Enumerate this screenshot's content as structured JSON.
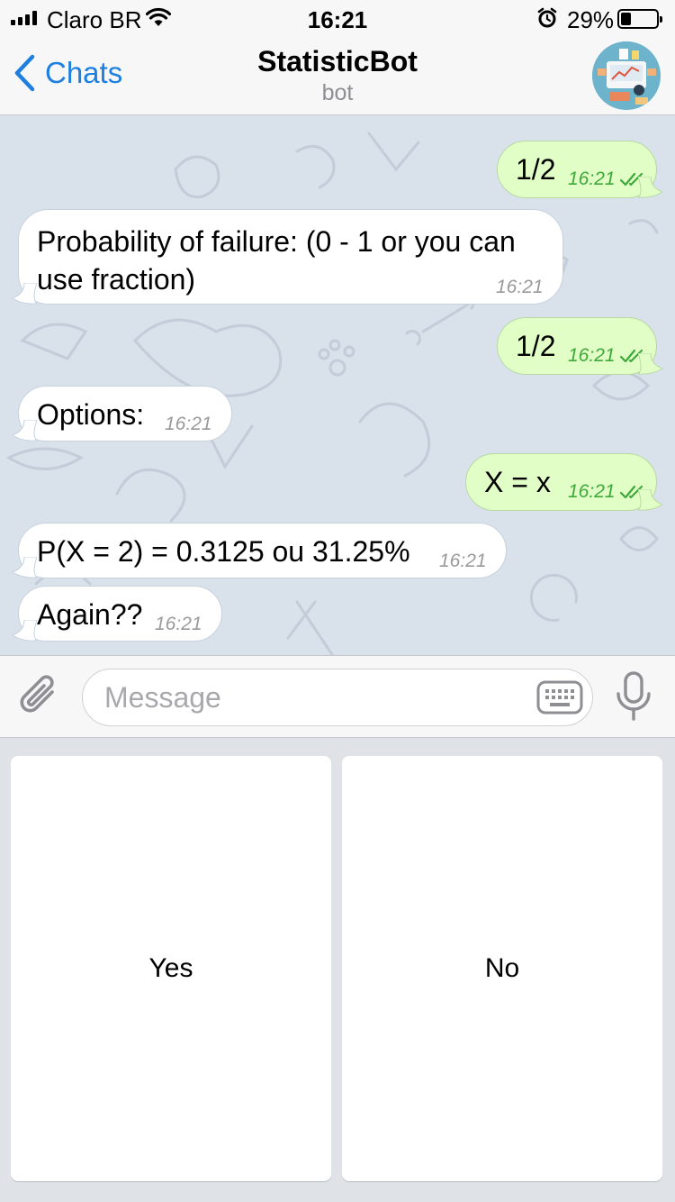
{
  "status_bar": {
    "carrier": "Claro BR",
    "time": "16:21",
    "battery_percent": "29%",
    "battery_level": 0.29,
    "icons": [
      "signal-icon",
      "wifi-icon",
      "alarm-icon",
      "battery-icon"
    ]
  },
  "nav": {
    "back_label": "Chats",
    "title": "StatisticBot",
    "subtitle": "bot"
  },
  "colors": {
    "accent": "#1d7fe0",
    "outgoing_bubble": "#e1fec6",
    "incoming_bubble": "#ffffff",
    "read_ticks": "#3ea93a",
    "chat_background": "#d9e1ea"
  },
  "messages": [
    {
      "direction": "out",
      "text": "1/2",
      "time": "16:21",
      "read": true
    },
    {
      "direction": "in",
      "lines": [
        "Probability of failure: (0 - 1 or you can",
        "use fraction)"
      ],
      "time": "16:21"
    },
    {
      "direction": "out",
      "text": "1/2",
      "time": "16:21",
      "read": true
    },
    {
      "direction": "in",
      "text": "Options:",
      "time": "16:21"
    },
    {
      "direction": "out",
      "text": "X = x",
      "time": "16:21",
      "read": true
    },
    {
      "direction": "in",
      "text": "P(X = 2) = 0.3125 ou 31.25%",
      "time": "16:21"
    },
    {
      "direction": "in",
      "text": "Again??",
      "time": "16:21"
    }
  ],
  "composer": {
    "placeholder": "Message",
    "icons": [
      "paperclip-icon",
      "keyboard-icon",
      "microphone-icon"
    ]
  },
  "reply_keyboard": {
    "buttons": [
      "Yes",
      "No"
    ]
  }
}
